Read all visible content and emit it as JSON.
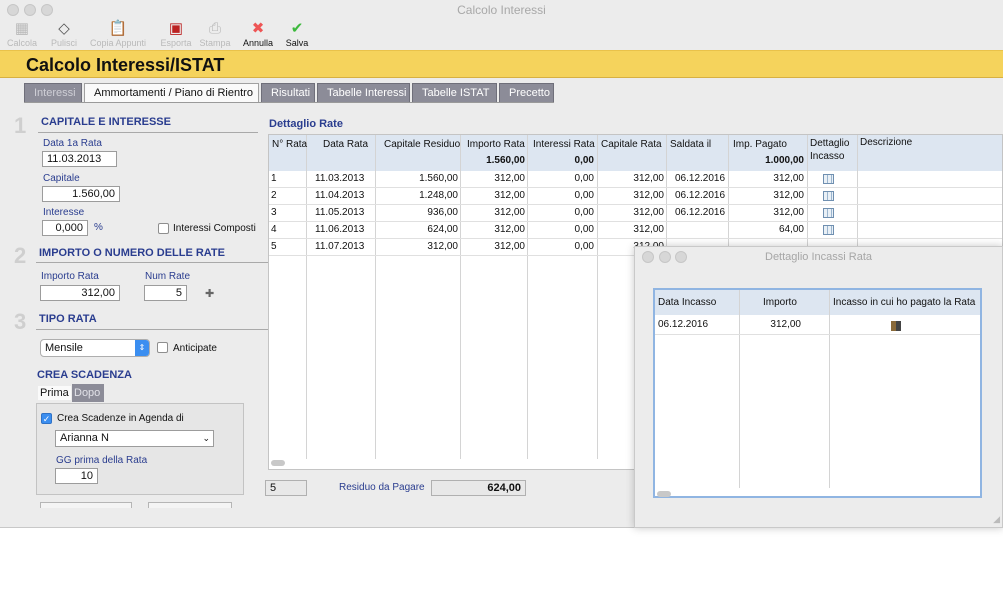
{
  "window": {
    "title": "Calcolo Interessi"
  },
  "toolbar": [
    {
      "label": "Calcola",
      "icon": "calculator-icon",
      "enabled": false
    },
    {
      "label": "Pulisci",
      "icon": "eraser-icon",
      "enabled": false
    },
    {
      "label": "Copia Appunti",
      "icon": "clipboard-icon",
      "enabled": false
    },
    {
      "label": "Esporta",
      "icon": "export-icon",
      "enabled": false
    },
    {
      "label": "Stampa",
      "icon": "printer-icon",
      "enabled": false
    },
    {
      "label": "Annulla",
      "icon": "cancel-x-icon",
      "enabled": true
    },
    {
      "label": "Salva",
      "icon": "save-checkmark-icon",
      "enabled": true
    }
  ],
  "banner": {
    "title": "Calcolo Interessi/ISTAT"
  },
  "tabs": [
    "Interessi",
    "Ammortamenti / Piano di Rientro",
    "Risultati",
    "Tabelle Interessi",
    "Tabelle ISTAT",
    "Precetto"
  ],
  "active_tab": "Ammortamenti / Piano di Rientro",
  "section1": {
    "number": "1",
    "title": "CAPITALE  E INTERESSE",
    "data_label": "Data 1a Rata",
    "data_value": "11.03.2013",
    "capitale_label": "Capitale",
    "capitale_value": "1.560,00",
    "interesse_label": "Interesse",
    "interesse_value": "0,000",
    "percent": "%",
    "composti_label": "Interessi Composti",
    "composti_checked": false
  },
  "section2": {
    "number": "2",
    "title": "IMPORTO O NUMERO DELLE RATE",
    "importo_label": "Importo Rata",
    "importo_value": "312,00",
    "num_label": "Num Rate",
    "num_value": "5",
    "plus": "✚"
  },
  "section3": {
    "number": "3",
    "title": "TIPO RATA",
    "select_value": "Mensile",
    "anticipate_label": "Anticipate",
    "anticipate_checked": false
  },
  "scadenza": {
    "title": "CREA SCADENZA",
    "tab_prima": "Prima",
    "tab_dopo": "Dopo",
    "agenda_label": "Crea Scadenze in Agenda di",
    "agenda_checked": true,
    "user_value": "Arianna N",
    "gg_label": "GG prima della Rata",
    "gg_value": "10"
  },
  "dettaglio": {
    "title": "Dettaglio Rate",
    "headers": [
      "N° Rata",
      "Data Rata",
      "Capitale Residuo",
      "Importo Rata",
      "Interessi Rata",
      "Capitale Rata",
      "Saldata il",
      "Imp. Pagato",
      "Dettaglio\nIncasso",
      "Descrizione"
    ],
    "totals": {
      "importo": "1.560,00",
      "interessi": "0,00",
      "pagato": "1.000,00"
    },
    "rows": [
      {
        "n": "1",
        "data": "11.03.2013",
        "residuo": "1.560,00",
        "importo": "312,00",
        "interessi": "0,00",
        "capitale": "312,00",
        "saldata": "06.12.2016",
        "pagato": "312,00",
        "icon": true
      },
      {
        "n": "2",
        "data": "11.04.2013",
        "residuo": "1.248,00",
        "importo": "312,00",
        "interessi": "0,00",
        "capitale": "312,00",
        "saldata": "06.12.2016",
        "pagato": "312,00",
        "icon": true
      },
      {
        "n": "3",
        "data": "11.05.2013",
        "residuo": "936,00",
        "importo": "312,00",
        "interessi": "0,00",
        "capitale": "312,00",
        "saldata": "06.12.2016",
        "pagato": "312,00",
        "icon": true
      },
      {
        "n": "4",
        "data": "11.06.2013",
        "residuo": "624,00",
        "importo": "312,00",
        "interessi": "0,00",
        "capitale": "312,00",
        "saldata": "",
        "pagato": "64,00",
        "icon": true
      },
      {
        "n": "5",
        "data": "11.07.2013",
        "residuo": "312,00",
        "importo": "312,00",
        "interessi": "0,00",
        "capitale": "312,00",
        "saldata": "",
        "pagato": "",
        "icon": false
      }
    ]
  },
  "footer": {
    "count": "5",
    "residuo_label": "Residuo da Pagare",
    "residuo_value": "624,00"
  },
  "popup": {
    "title": "Dettaglio Incassi Rata",
    "headers": [
      "Data Incasso",
      "Importo",
      "Incasso in cui ho pagato la Rata"
    ],
    "rows": [
      {
        "data": "06.12.2016",
        "importo": "312,00"
      }
    ]
  }
}
